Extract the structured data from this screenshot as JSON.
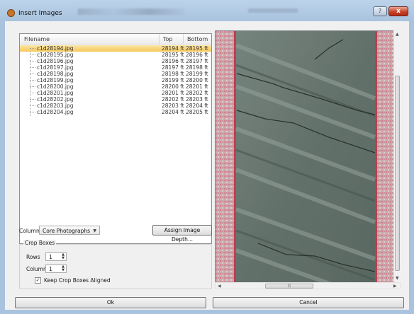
{
  "window": {
    "title": "Insert Images",
    "help_label": "?",
    "close_label": "x"
  },
  "file_list": {
    "headers": {
      "filename": "Filename",
      "top": "Top",
      "bottom": "Bottom"
    },
    "rows": [
      {
        "filename": "c1d28194.jpg",
        "top": "28194 ft",
        "bottom": "28195 ft",
        "selected": true
      },
      {
        "filename": "c1d28195.jpg",
        "top": "28195 ft",
        "bottom": "28196 ft"
      },
      {
        "filename": "c1d28196.jpg",
        "top": "28196 ft",
        "bottom": "28197 ft"
      },
      {
        "filename": "c1d28197.jpg",
        "top": "28197 ft",
        "bottom": "28198 ft"
      },
      {
        "filename": "c1d28198.jpg",
        "top": "28198 ft",
        "bottom": "28199 ft"
      },
      {
        "filename": "c1d28199.jpg",
        "top": "28199 ft",
        "bottom": "28200 ft"
      },
      {
        "filename": "c1d28200.jpg",
        "top": "28200 ft",
        "bottom": "28201 ft"
      },
      {
        "filename": "c1d28201.jpg",
        "top": "28201 ft",
        "bottom": "28202 ft"
      },
      {
        "filename": "c1d28202.jpg",
        "top": "28202 ft",
        "bottom": "28203 ft"
      },
      {
        "filename": "c1d28203.jpg",
        "top": "28203 ft",
        "bottom": "28204 ft"
      },
      {
        "filename": "c1d28204.jpg",
        "top": "28204 ft",
        "bottom": "28205 ft"
      }
    ]
  },
  "column": {
    "label": "Column",
    "value": "Core Photographs"
  },
  "assign_button": "Assign Image Depth...",
  "crop_boxes": {
    "title": "Crop Boxes",
    "rows_label": "Rows",
    "rows_value": "1",
    "columns_label": "Columns",
    "columns_value": "1",
    "keep_aligned_label": "Keep Crop Boxes Aligned",
    "keep_aligned_checked": true
  },
  "footer": {
    "ok": "Ok",
    "cancel": "Cancel"
  },
  "colors": {
    "selection": "#f5c85a",
    "core_rock": "#5d6e66",
    "core_edge": "#c5304a"
  }
}
